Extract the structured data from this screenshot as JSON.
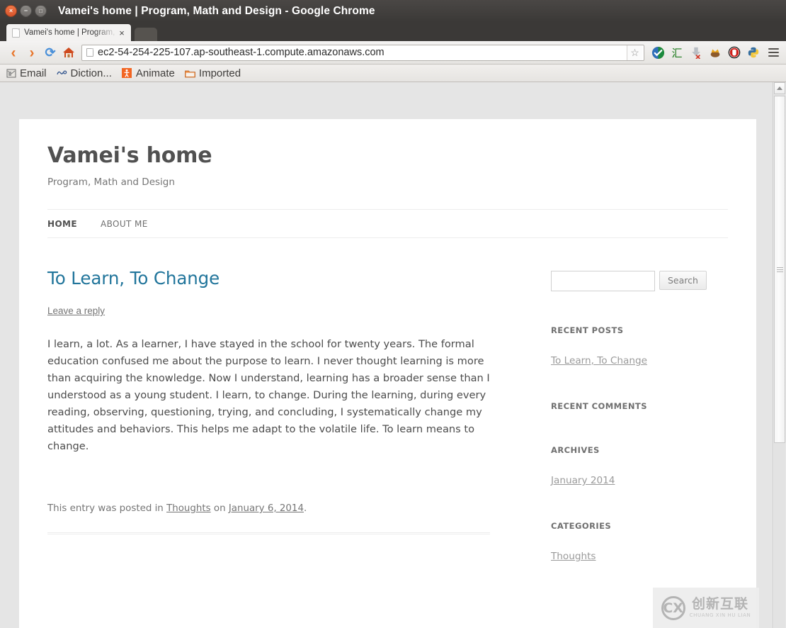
{
  "window": {
    "title": "Vamei's home | Program, Math and Design - Google Chrome",
    "buttons": {
      "close": "×",
      "minimize": "−",
      "maximize": "□"
    }
  },
  "tabs": [
    {
      "title": "Vamei's home | Program,",
      "close_label": "×",
      "icon": "page-icon"
    }
  ],
  "toolbar": {
    "back": "‹",
    "forward": "›",
    "reload": "⟳",
    "home": "home-icon",
    "url": "ec2-54-254-225-107.ap-southeast-1.compute.amazonaws.com",
    "star": "☆",
    "extensions": [
      {
        "name": "shield-check-icon"
      },
      {
        "name": "hui-character-icon",
        "glyph": "汇"
      },
      {
        "name": "download-blocked-icon"
      },
      {
        "name": "crown-icon"
      },
      {
        "name": "stop-hand-icon"
      },
      {
        "name": "python-icon"
      }
    ],
    "menu": "hamburger-menu-icon"
  },
  "bookmarks": [
    {
      "label": "Email",
      "icon": "mail-icon"
    },
    {
      "label": "Diction...",
      "icon": "dictionary-icon"
    },
    {
      "label": "Animate",
      "icon": "animate-icon"
    },
    {
      "label": "Imported",
      "icon": "folder-icon"
    }
  ],
  "site": {
    "title": "Vamei's home",
    "description": "Program, Math and Design",
    "nav": [
      {
        "label": "HOME",
        "current": true
      },
      {
        "label": "ABOUT ME",
        "current": false
      }
    ]
  },
  "post": {
    "title": "To Learn, To Change",
    "reply_link": "Leave a reply",
    "body": "I learn, a lot. As a learner, I have stayed in the school for twenty years. The formal education confused me about the purpose to learn. I never thought learning is more than acquiring the knowledge. Now I understand, learning has a broader sense than I understood as a young student. I learn, to change. During the learning, during every reading, observing, questioning, trying, and concluding, I systematically change my attitudes and behaviors. This helps me adapt to the volatile life. To learn means to change.",
    "meta_prefix": "This entry was posted in ",
    "meta_category": "Thoughts",
    "meta_mid": " on ",
    "meta_date": "January 6, 2014",
    "meta_suffix": "."
  },
  "sidebar": {
    "search": {
      "value": "",
      "placeholder": "",
      "button_label": "Search"
    },
    "widgets": [
      {
        "title": "RECENT POSTS",
        "items": [
          "To Learn, To Change"
        ]
      },
      {
        "title": "RECENT COMMENTS",
        "items": []
      },
      {
        "title": "ARCHIVES",
        "items": [
          "January 2014"
        ]
      },
      {
        "title": "CATEGORIES",
        "items": [
          "Thoughts"
        ]
      }
    ]
  },
  "watermark": {
    "logo": "CX",
    "chinese": "创新互联",
    "pinyin": "CHUANG XIN HU LIAN"
  },
  "scrollbar": {
    "position": "near-top"
  },
  "colors": {
    "accent_link": "#21759b",
    "title_bar": "#3b3937",
    "close_button": "#e8762c",
    "page_bg": "#e5e5e5"
  }
}
